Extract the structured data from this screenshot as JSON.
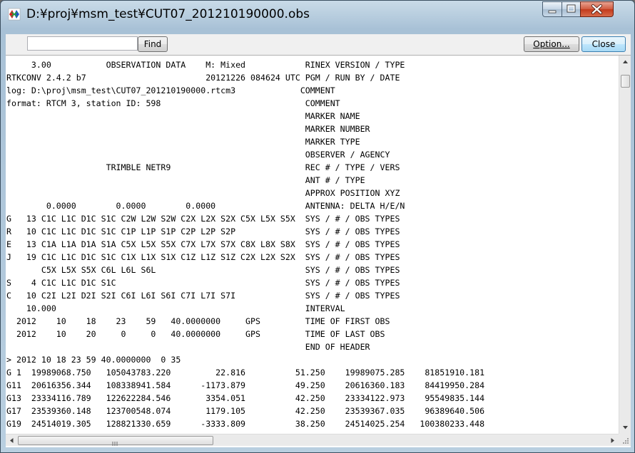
{
  "window": {
    "title": "D:¥proj¥msm_test¥CUT07_201210190000.obs"
  },
  "icons": {
    "app": "app-icon",
    "minimize": "minimize-icon",
    "maximize": "maximize-icon",
    "close": "close-icon"
  },
  "toolbar": {
    "find_value": "",
    "find_label": "Find",
    "option_label": "Option...",
    "close_label": "Close"
  },
  "content": {
    "lines": [
      "     3.00           OBSERVATION DATA    M: Mixed            RINEX VERSION / TYPE",
      "RTKCONV 2.4.2 b7                        20121226 084624 UTC PGM / RUN BY / DATE",
      "log: D:\\proj\\msm_test\\CUT07_201210190000.rtcm3             COMMENT",
      "format: RTCM 3, station ID: 598                             COMMENT",
      "                                                            MARKER NAME",
      "                                                            MARKER NUMBER",
      "                                                            MARKER TYPE",
      "                                                            OBSERVER / AGENCY",
      "                    TRIMBLE NETR9                           REC # / TYPE / VERS",
      "                                                            ANT # / TYPE",
      "                                                            APPROX POSITION XYZ",
      "        0.0000        0.0000        0.0000                  ANTENNA: DELTA H/E/N",
      "G   13 C1C L1C D1C S1C C2W L2W S2W C2X L2X S2X C5X L5X S5X  SYS / # / OBS TYPES",
      "R   10 C1C L1C D1C S1C C1P L1P S1P C2P L2P S2P              SYS / # / OBS TYPES",
      "E   13 C1A L1A D1A S1A C5X L5X S5X C7X L7X S7X C8X L8X S8X  SYS / # / OBS TYPES",
      "J   19 C1C L1C D1C S1C C1X L1X S1X C1Z L1Z S1Z C2X L2X S2X  SYS / # / OBS TYPES",
      "       C5X L5X S5X C6L L6L S6L                              SYS / # / OBS TYPES",
      "S    4 C1C L1C D1C S1C                                      SYS / # / OBS TYPES",
      "C   10 C2I L2I D2I S2I C6I L6I S6I C7I L7I S7I              SYS / # / OBS TYPES",
      "    10.000                                                  INTERVAL",
      "  2012    10    18    23    59   40.0000000     GPS         TIME OF FIRST OBS",
      "  2012    10    20     0     0   40.0000000     GPS         TIME OF LAST OBS",
      "                                                            END OF HEADER",
      "> 2012 10 18 23 59 40.0000000  0 35",
      "G 1  19989068.750   105043783.220         22.816          51.250    19989075.285    81851910.181",
      "G11  20616356.344   108338941.584      -1173.879          49.250    20616360.183    84419950.284",
      "G13  23334116.789   122622284.546       3354.051          42.250    23334122.973    95549835.144",
      "G17  23539360.148   123700548.074       1179.105          42.250    23539367.035    96389640.506",
      "G19  24514019.305   128821330.659      -3333.809          38.250    24514025.254   100380233.448"
    ]
  }
}
